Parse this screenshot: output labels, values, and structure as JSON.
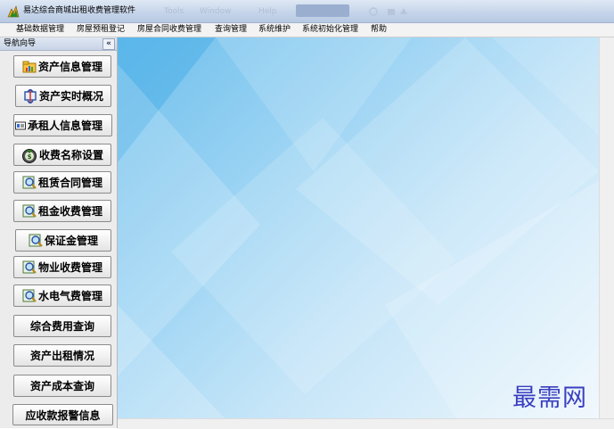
{
  "window": {
    "title": "易达综合商城出租收费管理软件",
    "ghost_menu": [
      "Tools",
      "Window",
      "Help"
    ]
  },
  "menubar": {
    "items": [
      "基础数据管理",
      "房屋预租登记",
      "房屋合同收费管理",
      "查询管理",
      "系统维护",
      "系统初始化管理",
      "帮助"
    ]
  },
  "sidebar": {
    "title": "导航向导",
    "collapse_label": "«",
    "items": [
      {
        "label": "资产信息管理",
        "icon": "folder-chart-icon"
      },
      {
        "label": "资产实时概况",
        "icon": "monitor-arrows-icon"
      },
      {
        "label": "承租人信息管理",
        "icon": "id-card-icon"
      },
      {
        "label": "收费名称设置",
        "icon": "money-bag-icon"
      },
      {
        "label": "租赁合同管理",
        "icon": "magnifier-document-icon"
      },
      {
        "label": "租金收费管理",
        "icon": "magnifier-document-icon"
      },
      {
        "label": "保证金管理",
        "icon": "magnifier-document-icon"
      },
      {
        "label": "物业收费管理",
        "icon": "magnifier-document-icon"
      },
      {
        "label": "水电气费管理",
        "icon": "magnifier-document-icon"
      },
      {
        "label": "综合费用查询",
        "icon": ""
      },
      {
        "label": "资产出租情况",
        "icon": ""
      },
      {
        "label": "资产成本查询",
        "icon": ""
      },
      {
        "label": "应收款报警信息",
        "icon": ""
      }
    ]
  },
  "watermark": {
    "text": "最需网"
  }
}
